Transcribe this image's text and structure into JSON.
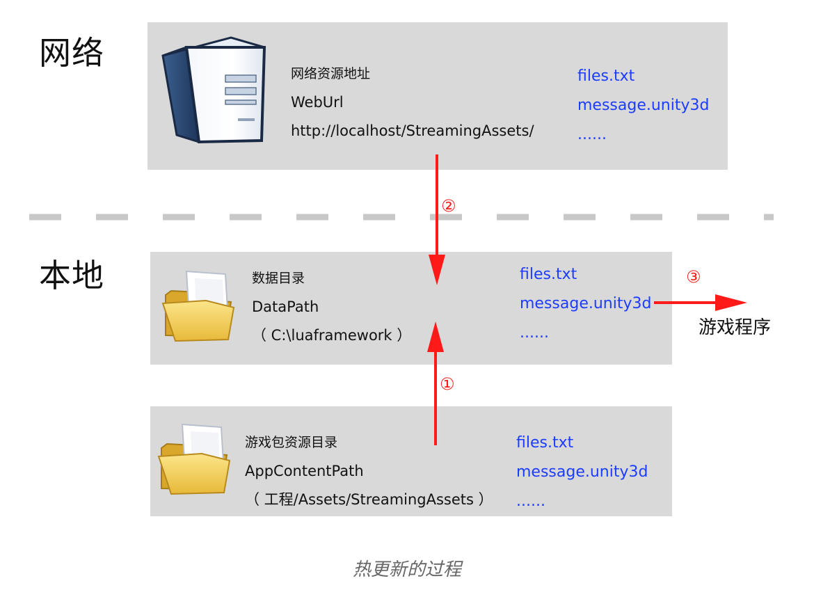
{
  "sections": {
    "network_label": "网络",
    "local_label": "本地"
  },
  "web_box": {
    "title": "网络资源地址",
    "name": "WebUrl",
    "path": "http://localhost/StreamingAssets/",
    "files": [
      "files.txt",
      "message.unity3d",
      "......"
    ],
    "icon": "server-icon"
  },
  "data_box": {
    "title": "数据目录",
    "name": "DataPath",
    "path": "（ C:\\luaframework ）",
    "files": [
      "files.txt",
      "message.unity3d",
      "......"
    ],
    "icon": "folder-icon"
  },
  "app_box": {
    "title": "游戏包资源目录",
    "name": "AppContentPath",
    "path": "（ 工程/Assets/StreamingAssets ）",
    "files": [
      "files.txt",
      "message.unity3d",
      "......"
    ],
    "icon": "folder-icon"
  },
  "steps": {
    "one": "①",
    "two": "②",
    "three": "③"
  },
  "target": "游戏程序",
  "caption": "热更新的过程",
  "colors": {
    "box": "#d9d9d9",
    "arrow": "#ff1a1a",
    "file_text": "#1c3cff",
    "divider": "#c8c8c8"
  }
}
